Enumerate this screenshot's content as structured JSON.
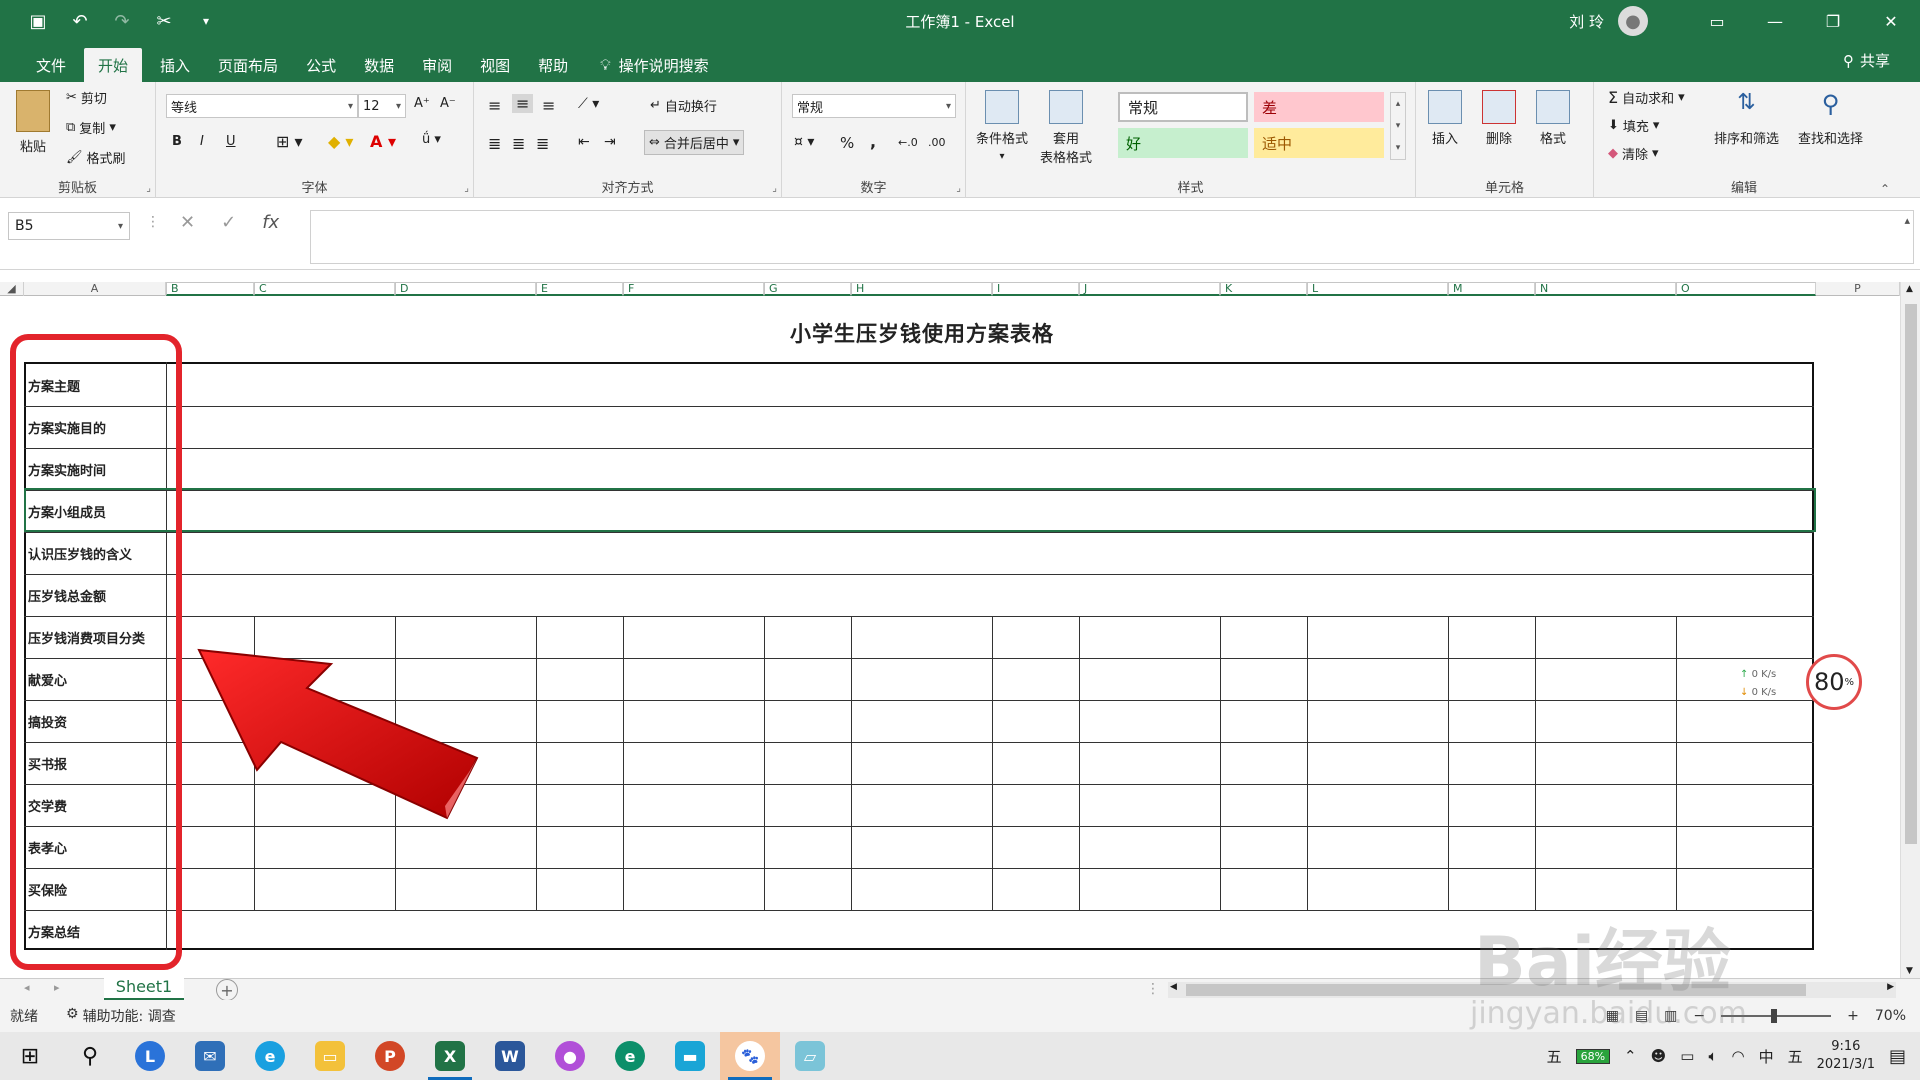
{
  "window": {
    "doc_title": "工作簿1  -  Excel",
    "user": "刘 玲"
  },
  "tabs": [
    "文件",
    "开始",
    "插入",
    "页面布局",
    "公式",
    "数据",
    "审阅",
    "视图",
    "帮助"
  ],
  "active_tab": "开始",
  "tellme": "操作说明搜索",
  "share": "共享",
  "ribbon": {
    "clipboard": {
      "label": "剪贴板",
      "paste": "粘贴",
      "cut": "剪切",
      "copy": "复制",
      "format_painter": "格式刷"
    },
    "font": {
      "label": "字体",
      "name": "等线",
      "size": "12",
      "bold": "B",
      "italic": "I",
      "underline": "U"
    },
    "alignment": {
      "label": "对齐方式",
      "wrap": "自动换行",
      "merge": "合并后居中"
    },
    "number": {
      "label": "数字",
      "format": "常规",
      "percent": "%",
      "comma": ","
    },
    "styles": {
      "label": "样式",
      "cond_format": "条件格式",
      "table_format_1": "套用",
      "table_format_2": "表格格式",
      "normal": "常规",
      "bad": "差",
      "good": "好",
      "neutral": "适中"
    },
    "cells": {
      "label": "单元格",
      "insert": "插入",
      "delete": "删除",
      "format": "格式"
    },
    "editing": {
      "label": "编辑",
      "autosum": "自动求和",
      "fill": "填充",
      "clear": "清除",
      "sort": "排序和筛选",
      "find": "查找和选择"
    }
  },
  "name_box": "B5",
  "columns": [
    "A",
    "B",
    "C",
    "D",
    "E",
    "F",
    "G",
    "H",
    "I",
    "J",
    "K",
    "L",
    "M",
    "N",
    "O",
    "P"
  ],
  "sheet_title": "小学生压岁钱使用方案表格",
  "row_labels": [
    "方案主题",
    "方案实施目的",
    "方案实施时间",
    "方案小组成员",
    "认识压岁钱的含义",
    "压岁钱总金额",
    "压岁钱消费项目分类",
    "献爱心",
    "搞投资",
    "买书报",
    "交学费",
    "表孝心",
    "买保险",
    "方案总结"
  ],
  "net_widget": {
    "up": "0  K/s",
    "down": "0  K/s",
    "percent": "80",
    "unit": "%"
  },
  "sheet_tab": "Sheet1",
  "status": {
    "ready": "就绪",
    "accessibility": "辅助功能: 调查",
    "zoom": "70%"
  },
  "taskbar": {
    "ime1": "五",
    "battery": "68%",
    "lang": "中",
    "ime2": "五",
    "time": "9:16",
    "date": "2021/3/1"
  },
  "watermark": {
    "brand": "Bai经验",
    "url": "jingyan.baidu.com"
  },
  "colors": {
    "excel_green": "#217346",
    "highlight_red": "#e3242b",
    "bad_fill": "#ffc7ce",
    "good_fill": "#c6efce",
    "neutral_fill": "#ffeb9c"
  }
}
